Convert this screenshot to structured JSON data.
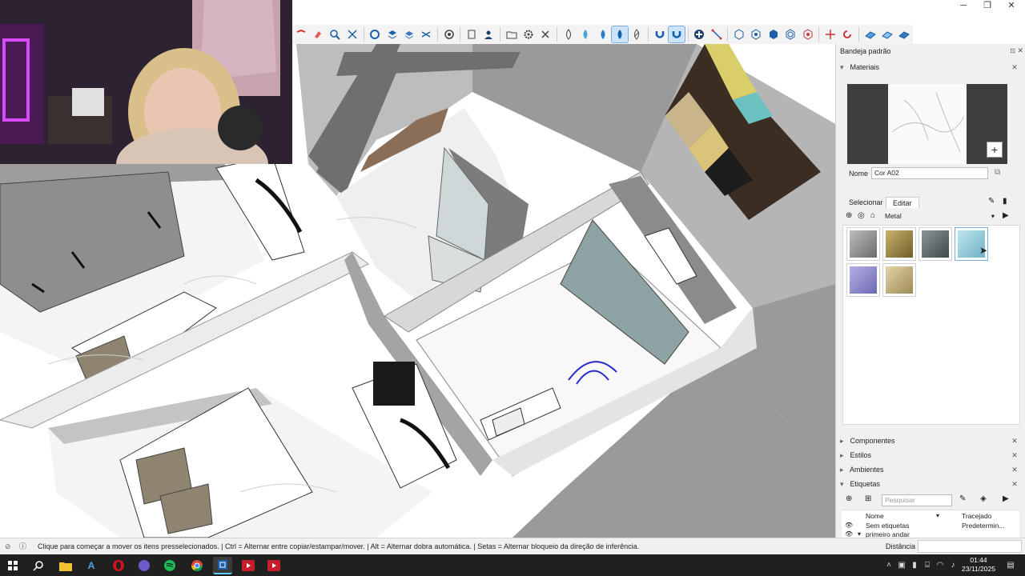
{
  "tray": {
    "title": "Bandeja padrão",
    "materials": {
      "header": "Materiais",
      "name_label": "Nome",
      "name_value": "Cor A02",
      "tab_select": "Selecionar",
      "tab_edit": "Editar",
      "library_value": "Metal"
    },
    "collapsed": [
      "Componentes",
      "Estilos",
      "Ambientes"
    ],
    "tags": {
      "header": "Etiquetas",
      "search_placeholder": "Pesquisar",
      "col_name": "Nome",
      "col_dashes": "Tracejado",
      "rows": [
        {
          "name": "Sem etiquetas",
          "dash": "Predetermin..."
        },
        {
          "name": "primeiro andar",
          "dash": ""
        }
      ]
    }
  },
  "status": {
    "message": "Clique para começar a mover os itens presselecionados. | Ctrl = Alternar entre copiar/estampar/mover. | Alt = Alternar dobra automática. | Setas = Alternar bloqueio da direção de inferência.",
    "measure_label": "Distância"
  },
  "clock": {
    "time": "01:44",
    "date": "23/11/2025"
  },
  "colors": {
    "accent": "#0078d7",
    "tray_bg": "#f0f0f0",
    "taskbar": "#202020"
  }
}
